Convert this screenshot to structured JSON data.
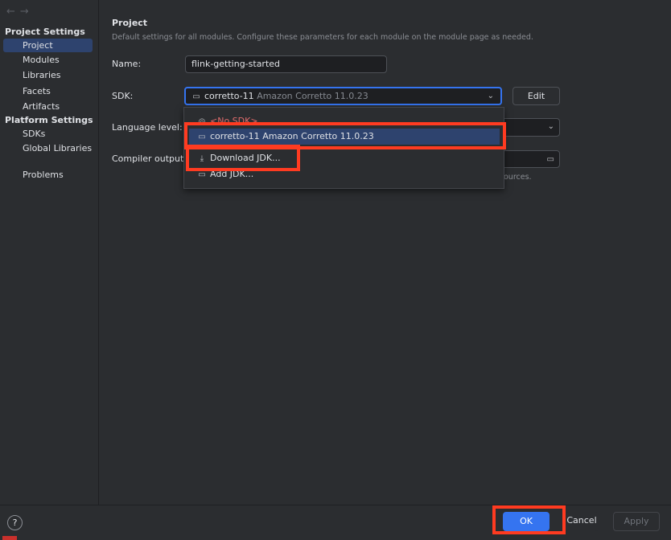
{
  "sidebar": {
    "nav_back": "←",
    "nav_forward": "→",
    "project_settings_title": "Project Settings",
    "project_items": [
      "Project",
      "Modules",
      "Libraries",
      "Facets",
      "Artifacts"
    ],
    "platform_settings_title": "Platform Settings",
    "platform_items": [
      "SDKs",
      "Global Libraries"
    ],
    "problems_label": "Problems",
    "selected_item": "Project"
  },
  "main": {
    "title": "Project",
    "description": "Default settings for all modules. Configure these parameters for each module on the module page as needed.",
    "name_label": "Name:",
    "name_value": "flink-getting-started",
    "sdk_label": "SDK:",
    "sdk_value_name": "corretto-11",
    "sdk_value_version": "Amazon Corretto 11.0.23",
    "edit_button": "Edit",
    "language_level_label": "Language level:",
    "compiler_output_label": "Compiler output:",
    "compiler_hint_tail": "ources."
  },
  "dropdown": {
    "no_sdk": "<No SDK>",
    "selected_sdk_name": "corretto-11",
    "selected_sdk_version": "Amazon Corretto 11.0.23",
    "download_jdk": "Download JDK...",
    "add_jdk": "Add JDK..."
  },
  "footer": {
    "help": "?",
    "ok": "OK",
    "cancel": "Cancel",
    "apply": "Apply"
  },
  "colors": {
    "accent": "#3574f0",
    "selection": "#2e436e",
    "highlight": "#ff3b21",
    "background": "#2b2d30"
  }
}
